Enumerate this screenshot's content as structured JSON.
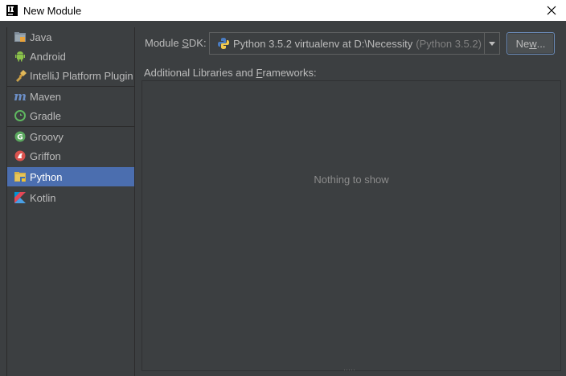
{
  "window": {
    "title": "New Module",
    "icon": "intellij-icon",
    "close_icon": "close-icon"
  },
  "sidebar": {
    "items": [
      {
        "label": "Java",
        "icon": "java-folder-icon"
      },
      {
        "label": "Android",
        "icon": "android-icon"
      },
      {
        "label": "IntelliJ Platform Plugin",
        "icon": "plugin-icon"
      },
      {
        "label": "Maven",
        "icon": "maven-icon"
      },
      {
        "label": "Gradle",
        "icon": "gradle-icon"
      },
      {
        "label": "Groovy",
        "icon": "groovy-icon"
      },
      {
        "label": "Griffon",
        "icon": "griffon-icon"
      },
      {
        "label": "Python",
        "icon": "python-folder-icon",
        "selected": true
      },
      {
        "label": "Kotlin",
        "icon": "kotlin-icon"
      }
    ]
  },
  "sdk": {
    "label_prefix": "Module ",
    "label_mnemonic": "S",
    "label_suffix": "DK:",
    "value": "Python 3.5.2 virtualenv at D:\\Necessity",
    "version": "(Python 3.5.2)",
    "new_button_prefix": "Ne",
    "new_button_mnemonic": "w",
    "new_button_suffix": "..."
  },
  "libraries": {
    "label_prefix": "Additional Libraries and ",
    "label_mnemonic": "F",
    "label_suffix": "rameworks:",
    "empty_text": "Nothing to show"
  },
  "colors": {
    "background": "#3c3f41",
    "selection": "#4b6eaf",
    "button_focus_border": "#6a8ab6"
  }
}
